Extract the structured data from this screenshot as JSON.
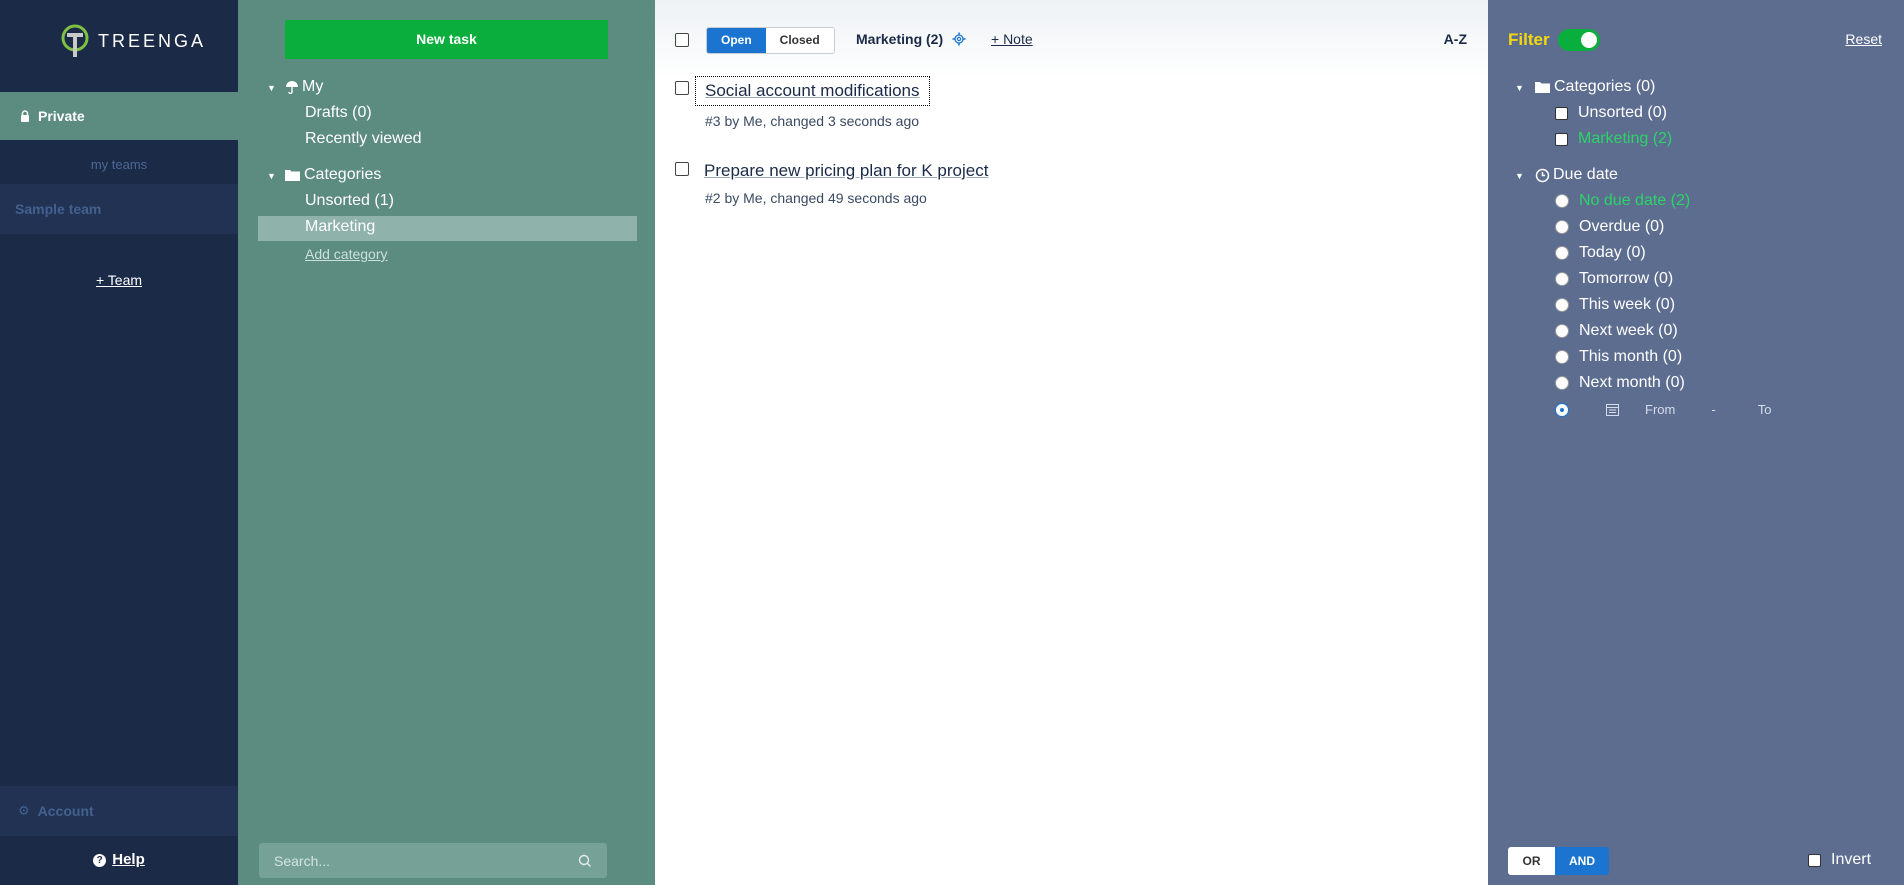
{
  "app": {
    "name": "TREENGA",
    "colors": {
      "accent": "#0aae3c",
      "nav": "#1b2a47",
      "panel": "#5c8b80",
      "filter": "#5d6d90",
      "highlight": "#f5d80f",
      "active_blue": "#1b75d0"
    }
  },
  "nav": {
    "private_label": "Private",
    "my_teams_label": "my teams",
    "team_name": "Sample team",
    "add_team_label": "+ Team",
    "account_label": "Account",
    "help_label": "Help"
  },
  "categories_panel": {
    "new_task_label": "New task",
    "my_label": "My",
    "drafts_label": "Drafts (0)",
    "recently_viewed_label": "Recently viewed",
    "categories_label": "Categories",
    "items": [
      {
        "label": "Unsorted (1)"
      },
      {
        "label": "Marketing",
        "selected": true
      }
    ],
    "add_category_label": "Add category",
    "search_placeholder": "Search..."
  },
  "tasks": {
    "open_label": "Open",
    "closed_label": "Closed",
    "category_title": "Marketing (2)",
    "note_label": "+ Note",
    "sort_label": "A-Z",
    "items": [
      {
        "title": "Social account modifications",
        "meta": "#3 by Me, changed 3 seconds ago"
      },
      {
        "title": "Prepare new pricing plan for K project",
        "meta": "#2 by Me, changed 49 seconds ago"
      }
    ]
  },
  "filter": {
    "title": "Filter",
    "reset_label": "Reset",
    "categories_label": "Categories (0)",
    "category_options": [
      {
        "label": "Unsorted (0)"
      },
      {
        "label": "Marketing (2)"
      }
    ],
    "due_date_label": "Due date",
    "due_options": [
      {
        "label": "No due date (2)"
      },
      {
        "label": "Overdue (0)"
      },
      {
        "label": "Today (0)"
      },
      {
        "label": "Tomorrow (0)"
      },
      {
        "label": "This week (0)"
      },
      {
        "label": "Next week (0)"
      },
      {
        "label": "This month (0)"
      },
      {
        "label": "Next month (0)"
      }
    ],
    "from_placeholder": "From",
    "range_separator": "-",
    "to_placeholder": "To",
    "or_label": "OR",
    "and_label": "AND",
    "invert_label": "Invert"
  }
}
